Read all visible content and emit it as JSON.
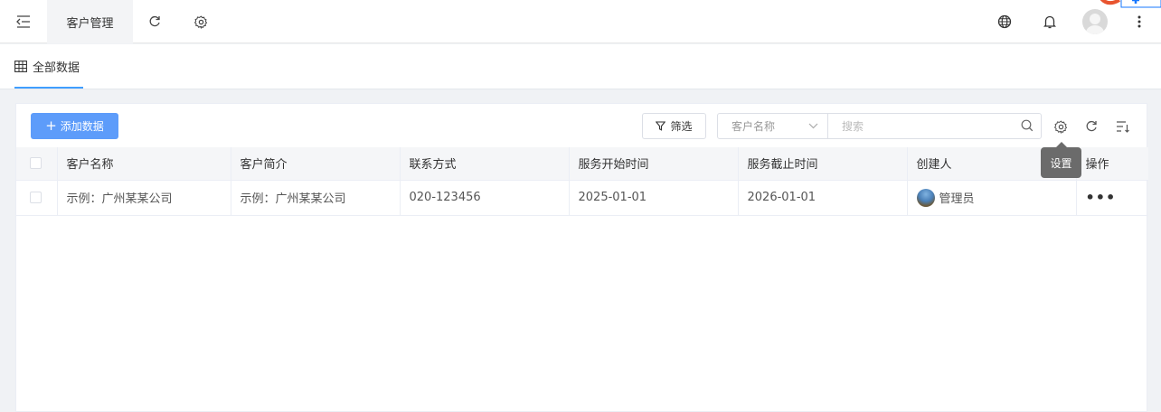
{
  "topbar": {
    "tab_label": "客户管理",
    "icons": [
      "collapse-menu-icon",
      "refresh-icon",
      "settings-icon",
      "globe-icon",
      "bell-icon",
      "avatar",
      "more-vertical-icon"
    ]
  },
  "tabs": {
    "all_data_label": "全部数据"
  },
  "toolbar": {
    "add_label": "添加数据",
    "filter_label": "筛选",
    "field_select_value": "客户名称",
    "search_placeholder": "搜索",
    "tooltip_text": "设置"
  },
  "table": {
    "columns": [
      "客户名称",
      "客户简介",
      "联系方式",
      "服务开始时间",
      "服务截止时间",
      "创建人",
      "操作"
    ],
    "rows": [
      {
        "name": "示例：广州某某公司",
        "intro": "示例：广州某某公司",
        "contact": "020-123456",
        "start": "2025-01-01",
        "end": "2026-01-01",
        "creator": "管理员",
        "actions": "•••"
      }
    ]
  },
  "colors": {
    "accent": "#409eff",
    "add_button": "#5d9cfa",
    "tooltip_bg": "#6b6b6b"
  }
}
